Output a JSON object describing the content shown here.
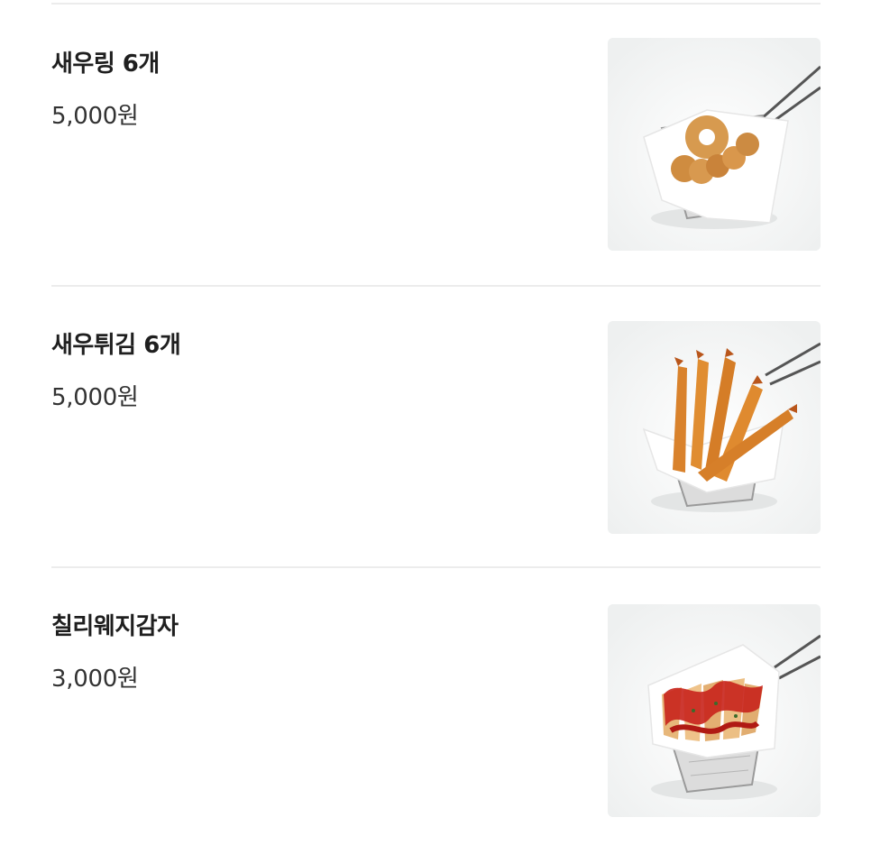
{
  "menu": {
    "items": [
      {
        "name": "새우링 6개",
        "price": "5,000원",
        "image_icon": "shrimp-ring-basket-image"
      },
      {
        "name": "새우튀김 6개",
        "price": "5,000원",
        "image_icon": "fried-shrimp-basket-image"
      },
      {
        "name": "칠리웨지감자",
        "price": "3,000원",
        "image_icon": "chili-wedge-potato-basket-image"
      }
    ]
  },
  "colors": {
    "divider": "#ececec",
    "name_text": "#1f1f1f",
    "price_text": "#333333",
    "thumb_bg": "#f4f5f5"
  }
}
